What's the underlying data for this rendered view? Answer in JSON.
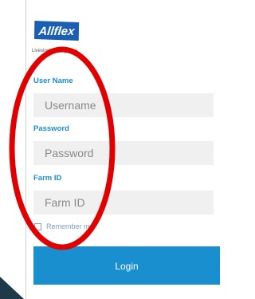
{
  "brand": {
    "name": "Allflex",
    "tagline": "Livestock Intelligence",
    "color": "#1a5fb4"
  },
  "form": {
    "username": {
      "label": "User Name",
      "placeholder": "Username",
      "value": ""
    },
    "password": {
      "label": "Password",
      "placeholder": "Password",
      "value": ""
    },
    "farm_id": {
      "label": "Farm ID",
      "placeholder": "Farm ID",
      "value": ""
    },
    "remember": {
      "label": "Remember m",
      "checked": false
    },
    "login_label": "Login"
  },
  "colors": {
    "accent": "#1a8fcf",
    "input_bg": "#f0f0f0",
    "annotation": "#e00000"
  }
}
